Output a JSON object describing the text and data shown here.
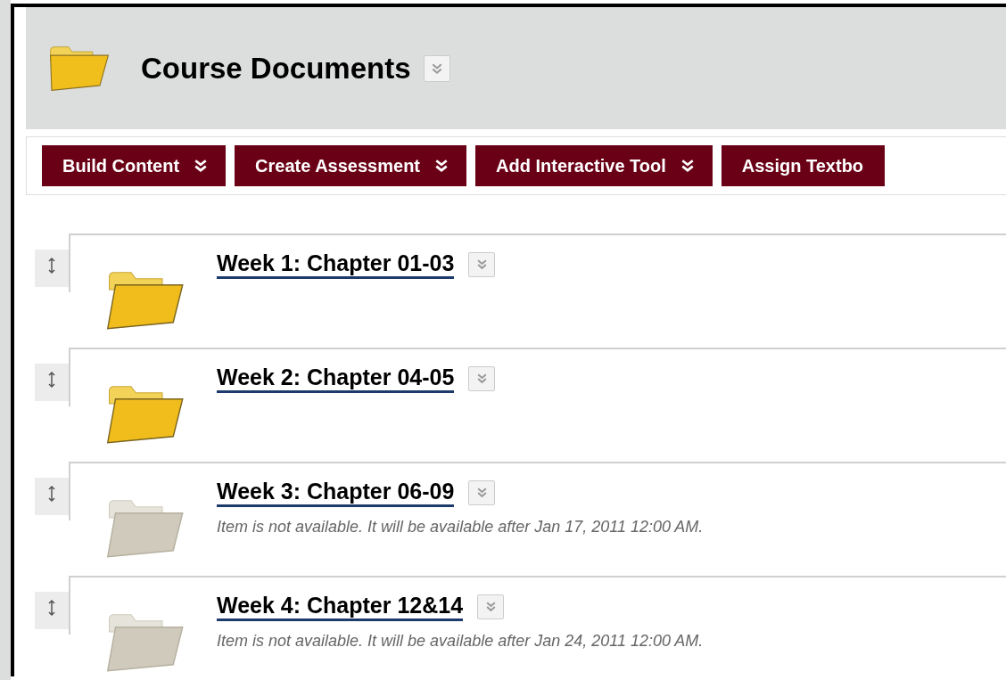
{
  "header": {
    "title": "Course Documents"
  },
  "toolbar": [
    "Build Content",
    "Create Assessment",
    "Add Interactive Tool",
    "Assign Textbo"
  ],
  "items": [
    {
      "title": "Week 1: Chapter 01-03",
      "available": true
    },
    {
      "title": "Week 2: Chapter 04-05",
      "available": true
    },
    {
      "title": "Week 3: Chapter 06-09",
      "available": false,
      "note": "Item is not available. It will be available after Jan 17, 2011 12:00 AM."
    },
    {
      "title": "Week 4: Chapter 12&14",
      "available": false,
      "note": "Item is not available. It will be available after Jan 24, 2011 12:00 AM."
    }
  ]
}
